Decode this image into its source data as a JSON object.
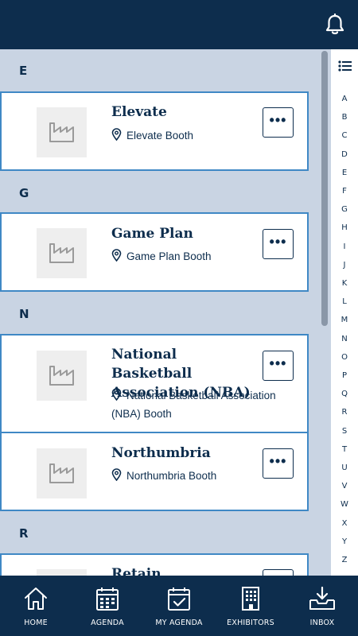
{
  "header": {
    "notification_icon": "bell-icon"
  },
  "sections": [
    {
      "letter": "E",
      "exhibitors": [
        {
          "name": "Elevate",
          "location": "Elevate Booth"
        }
      ]
    },
    {
      "letter": "G",
      "exhibitors": [
        {
          "name": "Game Plan",
          "location": "Game Plan Booth"
        }
      ]
    },
    {
      "letter": "N",
      "exhibitors": [
        {
          "name": "National Basketball Association (NBA)",
          "location": "National Basketball Association (NBA) Booth"
        },
        {
          "name": "Northumbria",
          "location": "Northumbria Booth"
        }
      ]
    },
    {
      "letter": "R",
      "exhibitors": [
        {
          "name": "Retain",
          "location": ""
        }
      ]
    }
  ],
  "more_button_label": "•••",
  "index": {
    "icon": "list-icon",
    "letters": [
      "A",
      "B",
      "C",
      "D",
      "E",
      "F",
      "G",
      "H",
      "I",
      "J",
      "K",
      "L",
      "M",
      "N",
      "O",
      "P",
      "Q",
      "R",
      "S",
      "T",
      "U",
      "V",
      "W",
      "X",
      "Y",
      "Z"
    ]
  },
  "bottom_nav": [
    {
      "label": "HOME",
      "icon": "home-icon"
    },
    {
      "label": "AGENDA",
      "icon": "calendar-icon"
    },
    {
      "label": "MY AGENDA",
      "icon": "calendar-check-icon"
    },
    {
      "label": "EXHIBITORS",
      "icon": "building-icon"
    },
    {
      "label": "INBOX",
      "icon": "inbox-download-icon"
    }
  ],
  "colors": {
    "navy": "#0d2d4d",
    "accent": "#3f88c5",
    "background": "#c9d4e3"
  }
}
